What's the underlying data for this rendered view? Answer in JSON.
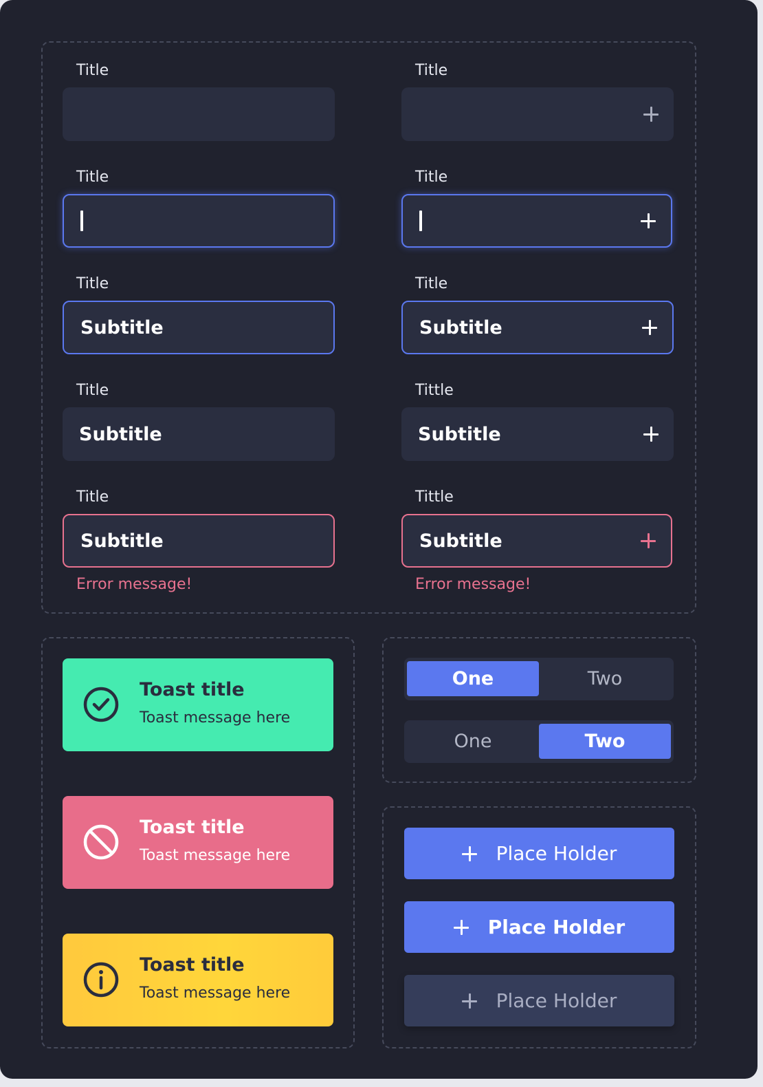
{
  "inputs": {
    "rows": [
      {
        "left": {
          "label": "Title",
          "value": ""
        },
        "right": {
          "label": "Title",
          "value": ""
        }
      },
      {
        "left": {
          "label": "Title",
          "value": ""
        },
        "right": {
          "label": "Title",
          "value": ""
        }
      },
      {
        "left": {
          "label": "Title",
          "value": "Subtitle"
        },
        "right": {
          "label": "Title",
          "value": "Subtitle"
        }
      },
      {
        "left": {
          "label": "Title",
          "value": "Subtitle"
        },
        "right": {
          "label": "Tittle",
          "value": "Subtitle"
        }
      },
      {
        "left": {
          "label": "Title",
          "value": "Subtitle",
          "error": "Error message!"
        },
        "right": {
          "label": "Tittle",
          "value": "Subtitle",
          "error": "Error message!"
        }
      }
    ]
  },
  "toasts": [
    {
      "variant": "success",
      "icon": "check-circle-icon",
      "title": "Toast title",
      "message": "Toast message here",
      "color": "#45ebb0"
    },
    {
      "variant": "error",
      "icon": "prohibited-icon",
      "title": "Toast title",
      "message": "Toast message here",
      "color": "#e86d8a"
    },
    {
      "variant": "warning",
      "icon": "info-icon",
      "title": "Toast title",
      "message": "Toast message here",
      "color": "#ffcf3a"
    }
  ],
  "segments": [
    {
      "options": [
        "One",
        "Two"
      ],
      "selected": "One"
    },
    {
      "options": [
        "One",
        "Two"
      ],
      "selected": "Two"
    }
  ],
  "buttons": [
    {
      "label": "Place Holder",
      "state": "default",
      "icon": "plus-icon"
    },
    {
      "label": "Place Holder",
      "state": "hover",
      "icon": "plus-icon"
    },
    {
      "label": "Place Holder",
      "state": "disabled",
      "icon": "plus-icon"
    }
  ],
  "colors": {
    "background": "#20222e",
    "field": "#2a2e40",
    "accent": "#5b78ef",
    "error": "#e8728f",
    "success": "#45ebb0",
    "warning": "#ffcf3a"
  }
}
